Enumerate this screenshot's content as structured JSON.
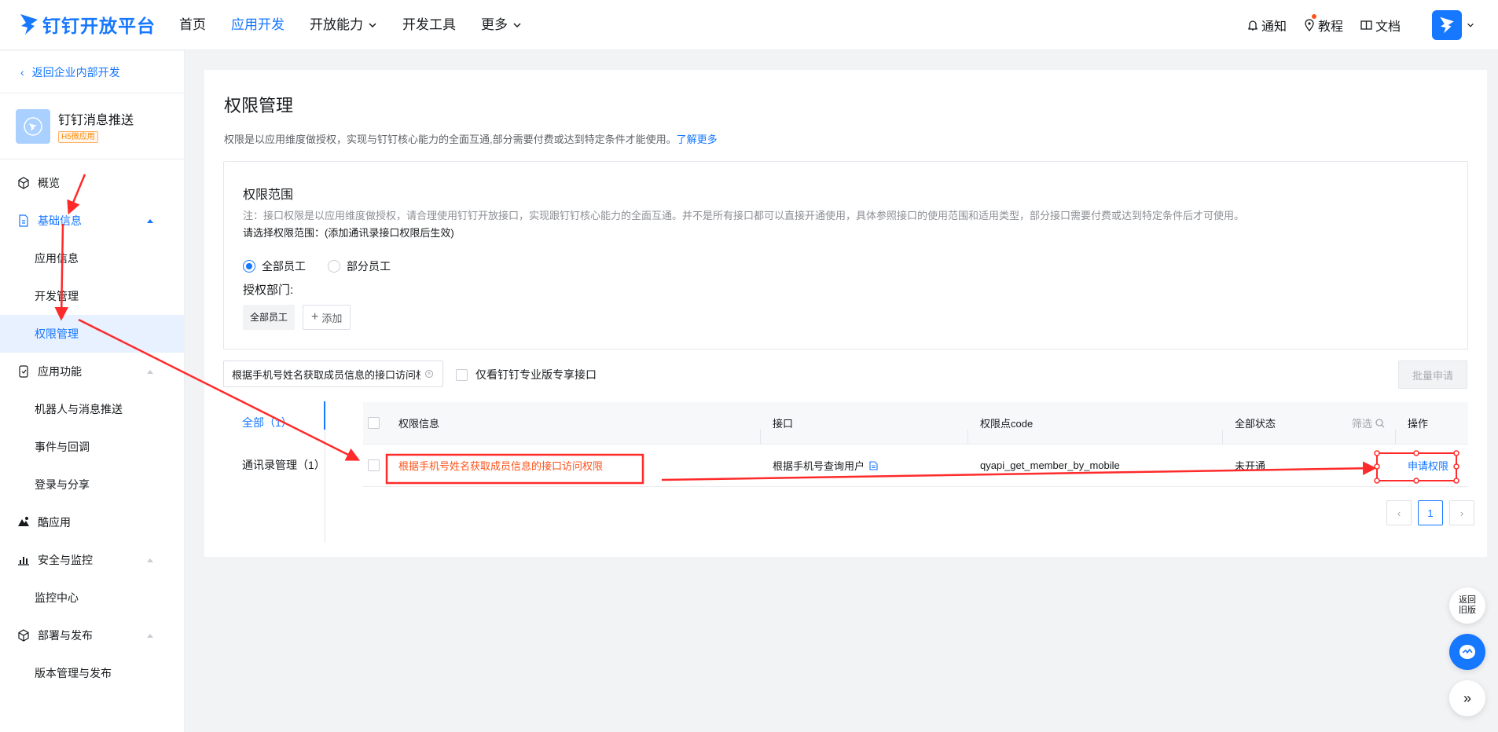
{
  "brand": {
    "name": "钉钉开放平台"
  },
  "nav": {
    "items": [
      {
        "label": "首页"
      },
      {
        "label": "应用开发"
      },
      {
        "label": "开放能力"
      },
      {
        "label": "开发工具"
      },
      {
        "label": "更多"
      }
    ]
  },
  "tools": {
    "notify": "通知",
    "tutorial": "教程",
    "docs": "文档"
  },
  "sidebar": {
    "back": "返回企业内部开发",
    "app": {
      "name": "钉钉消息推送",
      "tag": "H5微应用"
    },
    "menu": {
      "overview": "概览",
      "basic": "基础信息",
      "basic_sub": [
        "应用信息",
        "开发管理",
        "权限管理"
      ],
      "features": "应用功能",
      "features_sub": [
        "机器人与消息推送",
        "事件与回调",
        "登录与分享"
      ],
      "cool_app": "酷应用",
      "security": "安全与监控",
      "security_sub": [
        "监控中心"
      ],
      "deploy": "部署与发布",
      "deploy_sub": [
        "版本管理与发布"
      ]
    }
  },
  "page": {
    "title": "权限管理",
    "desc": "权限是以应用维度做授权，实现与钉钉核心能力的全面互通,部分需要付费或达到特定条件才能使用。",
    "learn_more": "了解更多",
    "scope": {
      "title": "权限范围",
      "note": "注：接口权限是以应用维度做授权，请合理使用钉钉开放接口，实现跟钉钉核心能力的全面互通。并不是所有接口都可以直接开通使用，具体参照接口的使用范围和适用类型，部分接口需要付费或达到特定条件后才可使用。",
      "hint": "请选择权限范围：(添加通讯录接口权限后生效)",
      "radio_all": "全部员工",
      "radio_part": "部分员工",
      "dept_label": "授权部门:",
      "dept_tag": "全部员工",
      "add": "添加"
    },
    "filter": {
      "value": "根据手机号姓名获取成员信息的接口访问权限",
      "pro_only": "仅看钉钉专业版专享接口",
      "batch": "批量申请"
    },
    "categories": [
      {
        "label": "全部（1）"
      },
      {
        "label": "通讯录管理（1）"
      }
    ],
    "table": {
      "headers": [
        "权限信息",
        "接口",
        "权限点code",
        "全部状态",
        "操作"
      ],
      "filter_label": "筛选",
      "rows": [
        {
          "perm": "根据手机号姓名获取成员信息的接口访问权限",
          "api": "根据手机号查询用户",
          "code": "qyapi_get_member_by_mobile",
          "status": "未开通",
          "action": "申请权限"
        }
      ]
    },
    "pager": {
      "current": "1"
    }
  },
  "floats": {
    "old_version": "返回旧版"
  },
  "colors": {
    "accent": "#1677ff",
    "annotation": "#ff2a2a",
    "warn": "#ff5219"
  }
}
